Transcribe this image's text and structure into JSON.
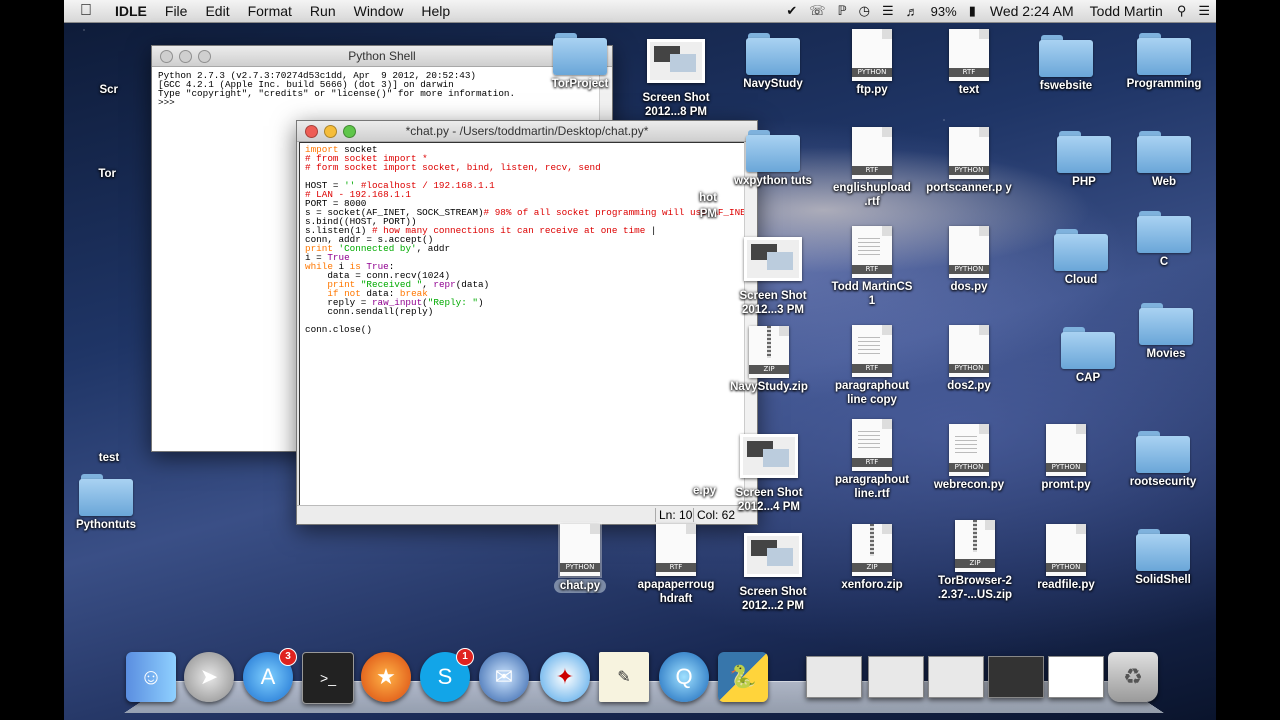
{
  "menubar": {
    "app": "IDLE",
    "items": [
      "File",
      "Edit",
      "Format",
      "Run",
      "Window",
      "Help"
    ],
    "battery": "93%",
    "clock": "Wed 2:24 AM",
    "user": "Todd Martin"
  },
  "shell": {
    "title": "Python Shell",
    "lines": [
      "Python 2.7.3 (v2.7.3:70274d53c1dd, Apr  9 2012, 20:52:43)",
      "[GCC 4.2.1 (Apple Inc. build 5666) (dot 3)] on darwin",
      "Type \"copyright\", \"credits\" or \"license()\" for more information.",
      ">>>"
    ]
  },
  "editor": {
    "title": "*chat.py - /Users/toddmartin/Desktop/chat.py*",
    "status_ln": "Ln: 10",
    "status_col": "Col: 62"
  },
  "desktop": {
    "left_labels": [
      "Scr",
      "Tor",
      "test",
      "Pythontuts"
    ],
    "icons": [
      {
        "label": "TorProject"
      },
      {
        "label": "Screen Shot 2012...8 PM"
      },
      {
        "label": "NavyStudy"
      },
      {
        "label": "ftp.py"
      },
      {
        "label": "text"
      },
      {
        "label": "fswebsite"
      },
      {
        "label": "Programming"
      },
      {
        "label": "hot"
      },
      {
        "label": "PM"
      },
      {
        "label": "wxpython tuts"
      },
      {
        "label": "englishupload .rtf"
      },
      {
        "label": "portscanner.p y"
      },
      {
        "label": "PHP"
      },
      {
        "label": "Web"
      },
      {
        "label": "Screen Shot 2012...3 PM"
      },
      {
        "label": "Todd MartinCS 1"
      },
      {
        "label": "dos.py"
      },
      {
        "label": "Cloud"
      },
      {
        "label": "C"
      },
      {
        "label": "NavyStudy.zip"
      },
      {
        "label": "paragraphout line copy"
      },
      {
        "label": "dos2.py"
      },
      {
        "label": "CAP"
      },
      {
        "label": "Movies"
      },
      {
        "label": "Screen Shot 2012...4 PM"
      },
      {
        "label": "paragraphout line.rtf"
      },
      {
        "label": "webrecon.py"
      },
      {
        "label": "promt.py"
      },
      {
        "label": "rootsecurity"
      },
      {
        "label": "chat.py"
      },
      {
        "label": "apapaperroug hdraft"
      },
      {
        "label": "Screen Shot 2012...2 PM"
      },
      {
        "label": "xenforo.zip"
      },
      {
        "label": "TorBrowser-2 .2.37-...US.zip"
      },
      {
        "label": "readfile.py"
      },
      {
        "label": "SolidShell"
      },
      {
        "label": "e.py"
      }
    ],
    "type_labels": {
      "python": "PYTHON",
      "rtf": "RTF",
      "zip": "ZIP"
    }
  },
  "dock": {
    "appstore_badge": "3",
    "skype_badge": "1"
  },
  "colors": {
    "keyword": "#ff7700",
    "comment": "#dd0000",
    "string": "#00aa00",
    "builtin": "#900090"
  }
}
